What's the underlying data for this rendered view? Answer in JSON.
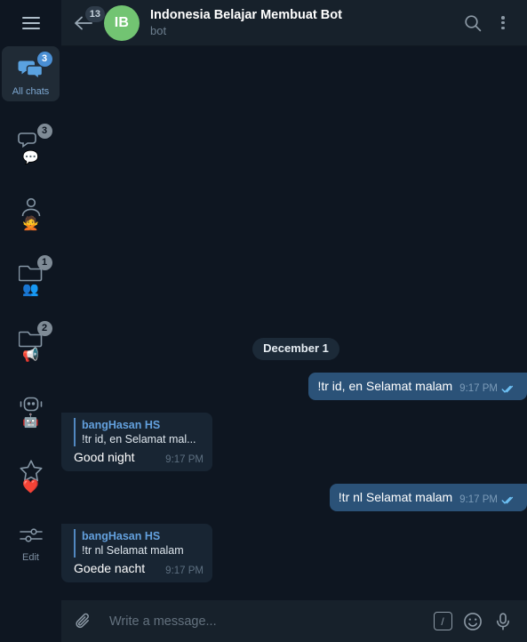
{
  "sidebar": {
    "menu_icon": "hamburger-icon",
    "items": [
      {
        "label": "All chats",
        "icon": "chats-icon",
        "badge": "3",
        "badge_accent": true,
        "emoji": "",
        "active": true
      },
      {
        "label": "",
        "icon": "chat-bubble-icon",
        "badge": "3",
        "badge_accent": false,
        "emoji": "💬",
        "active": false
      },
      {
        "label": "",
        "icon": "person-icon",
        "badge": "",
        "badge_accent": false,
        "emoji": "🙅",
        "active": false
      },
      {
        "label": "",
        "icon": "folder-icon",
        "badge": "1",
        "badge_accent": false,
        "emoji": "👥",
        "active": false
      },
      {
        "label": "",
        "icon": "folder-icon",
        "badge": "2",
        "badge_accent": false,
        "emoji": "📢",
        "active": false
      },
      {
        "label": "",
        "icon": "robot-icon",
        "badge": "",
        "badge_accent": false,
        "emoji": "🤖",
        "active": false
      },
      {
        "label": "",
        "icon": "star-icon",
        "badge": "",
        "badge_accent": false,
        "emoji": "❤️",
        "active": false
      },
      {
        "label": "Edit",
        "icon": "sliders-icon",
        "badge": "",
        "badge_accent": false,
        "emoji": "",
        "active": false
      }
    ]
  },
  "header": {
    "back_icon": "back-arrow-icon",
    "back_badge": "13",
    "avatar_initials": "IB",
    "avatar_color": "#72c472",
    "title": "Indonesia Belajar Membuat Bot",
    "subtitle": "bot",
    "search_icon": "search-icon",
    "menu_icon": "more-vertical-icon"
  },
  "conversation": {
    "date_separator": "December 1",
    "messages": [
      {
        "direction": "out",
        "text": "!tr id, en Selamat malam",
        "time": "9:17 PM",
        "status_icon": "double-check-icon",
        "reply": null
      },
      {
        "direction": "in",
        "text": "Good night",
        "time": "9:17 PM",
        "status_icon": "",
        "reply": {
          "name": "bangHasan HS",
          "text": "!tr id, en Selamat mal..."
        }
      },
      {
        "direction": "out",
        "text": "!tr nl Selamat malam",
        "time": "9:17 PM",
        "status_icon": "double-check-icon",
        "reply": null
      },
      {
        "direction": "in",
        "text": "Goede nacht",
        "time": "9:17 PM",
        "status_icon": "",
        "reply": {
          "name": "bangHasan HS",
          "text": "!tr nl Selamat malam"
        }
      }
    ]
  },
  "composer": {
    "attach_icon": "paperclip-icon",
    "placeholder": "Write a message...",
    "input_value": "",
    "command_label": "/",
    "emoji_icon": "smiley-icon",
    "voice_icon": "microphone-icon"
  },
  "colors": {
    "app_bg": "#0e1621",
    "panel_bg": "#17212b",
    "bubble_out": "#2b5278",
    "bubble_in": "#182533",
    "accent_blue": "#5288c1",
    "avatar_green": "#72c472"
  }
}
